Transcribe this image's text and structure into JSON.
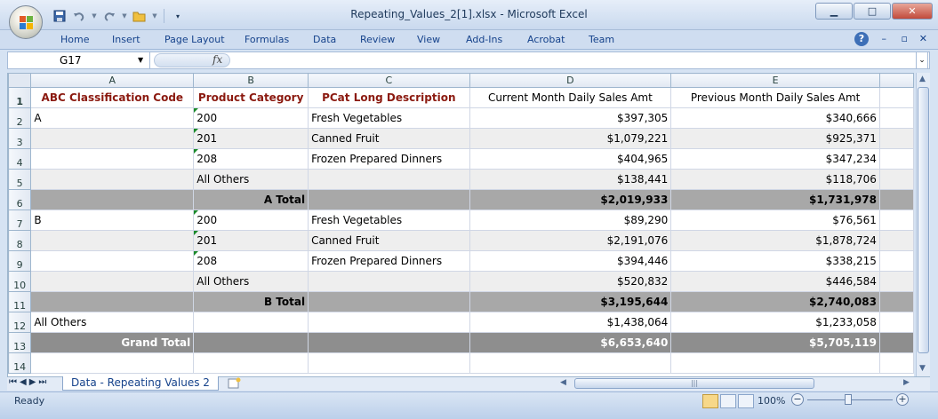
{
  "window": {
    "title": "Repeating_Values_2[1].xlsx - Microsoft Excel"
  },
  "ribbon": {
    "tabs": [
      "Home",
      "Insert",
      "Page Layout",
      "Formulas",
      "Data",
      "Review",
      "View",
      "Add-Ins",
      "Acrobat",
      "Team"
    ],
    "help": "?"
  },
  "formula_bar": {
    "name_box": "G17",
    "fx": "fx",
    "formula": ""
  },
  "columns": [
    "A",
    "B",
    "C",
    "D",
    "E"
  ],
  "rows": [
    {
      "n": "1",
      "type": "header",
      "cells": [
        "ABC Classification Code",
        "Product Category",
        "PCat Long Description",
        "Current Month Daily Sales Amt",
        "Previous Month Daily Sales Amt"
      ]
    },
    {
      "n": "2",
      "type": "white",
      "cells": [
        "A",
        "200",
        "Fresh Vegetables",
        "$397,305",
        "$340,666"
      ],
      "tri": true
    },
    {
      "n": "3",
      "type": "band",
      "cells": [
        "",
        "201",
        "Canned Fruit",
        "$1,079,221",
        "$925,371"
      ],
      "tri": true
    },
    {
      "n": "4",
      "type": "white",
      "cells": [
        "",
        "208",
        "Frozen Prepared Dinners",
        "$404,965",
        "$347,234"
      ],
      "tri": true
    },
    {
      "n": "5",
      "type": "band",
      "cells": [
        "",
        "All Others",
        "",
        "$138,441",
        "$118,706"
      ]
    },
    {
      "n": "6",
      "type": "total",
      "cells": [
        "",
        "A Total",
        "",
        "$2,019,933",
        "$1,731,978"
      ]
    },
    {
      "n": "7",
      "type": "white",
      "cells": [
        "B",
        "200",
        "Fresh Vegetables",
        "$89,290",
        "$76,561"
      ],
      "tri": true
    },
    {
      "n": "8",
      "type": "band",
      "cells": [
        "",
        "201",
        "Canned Fruit",
        "$2,191,076",
        "$1,878,724"
      ],
      "tri": true
    },
    {
      "n": "9",
      "type": "white",
      "cells": [
        "",
        "208",
        "Frozen Prepared Dinners",
        "$394,446",
        "$338,215"
      ],
      "tri": true
    },
    {
      "n": "10",
      "type": "band",
      "cells": [
        "",
        "All Others",
        "",
        "$520,832",
        "$446,584"
      ]
    },
    {
      "n": "11",
      "type": "total",
      "cells": [
        "",
        "B Total",
        "",
        "$3,195,644",
        "$2,740,083"
      ]
    },
    {
      "n": "12",
      "type": "white",
      "cells": [
        "All Others",
        "",
        "",
        "$1,438,064",
        "$1,233,058"
      ]
    },
    {
      "n": "13",
      "type": "grand",
      "cells": [
        "Grand Total",
        "",
        "",
        "$6,653,640",
        "$5,705,119"
      ]
    },
    {
      "n": "14",
      "type": "empty",
      "cells": [
        "",
        "",
        "",
        "",
        ""
      ]
    }
  ],
  "sheet_tabs": {
    "active": "Data - Repeating Values 2"
  },
  "status_bar": {
    "ready": "Ready",
    "zoom": "100%"
  },
  "colors": {
    "header_text": "#8b1a10",
    "total_fill": "#a8a8a8",
    "grand_fill": "#8e8e8e",
    "band_fill": "#eeeeee"
  }
}
